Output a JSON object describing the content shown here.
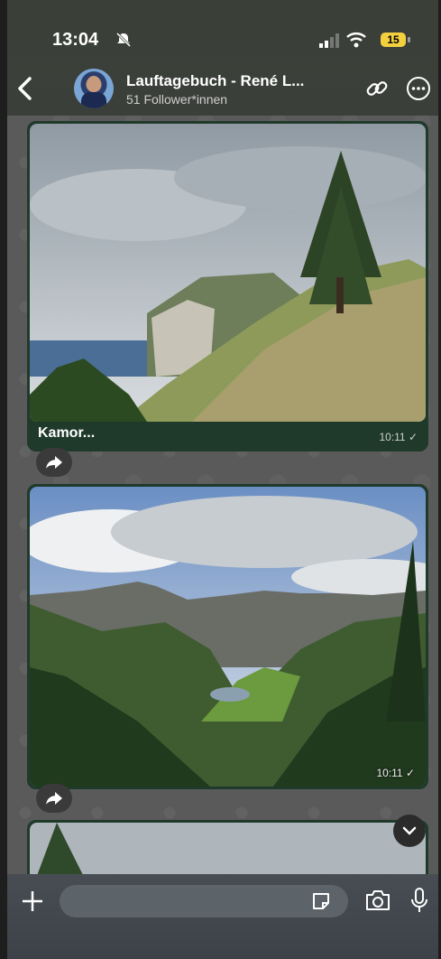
{
  "status_bar": {
    "time": "13:04",
    "battery": "15"
  },
  "header": {
    "title": "Lauftagebuch - René L...",
    "subtitle": "51 Follower*innen"
  },
  "messages": [
    {
      "caption": "Kamor...",
      "time": "10:11 ✓"
    },
    {
      "caption": "",
      "time": "10:11 ✓"
    }
  ],
  "composer": {
    "placeholder": ""
  },
  "icons": [
    "mute-icon",
    "signal-icon",
    "wifi-icon",
    "back-icon",
    "link-icon",
    "more-icon",
    "forward-icon",
    "chevron-down-icon",
    "plus-icon",
    "sticker-icon",
    "camera-icon",
    "mic-icon"
  ],
  "colors": {
    "bubble": "#1f3a2a",
    "battery": "#f4d03f"
  }
}
